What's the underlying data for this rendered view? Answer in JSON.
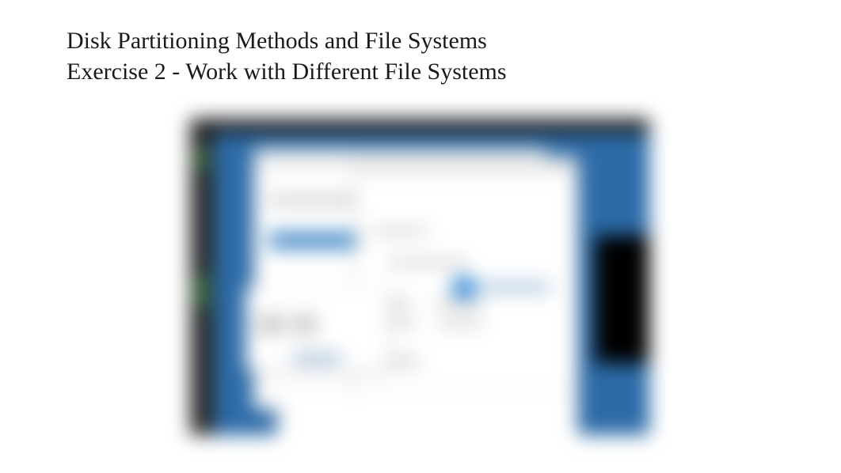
{
  "header": {
    "title": "Disk Partitioning Methods and File Systems",
    "subtitle": "Exercise 2 - Work with Different File Systems"
  },
  "screenshot": {
    "description": "blurred-desktop-screenshot",
    "desktop_color": "#2c6ba8",
    "has_taskbar": true,
    "has_side_panel": true,
    "has_terminal": true,
    "window_count": 4
  }
}
